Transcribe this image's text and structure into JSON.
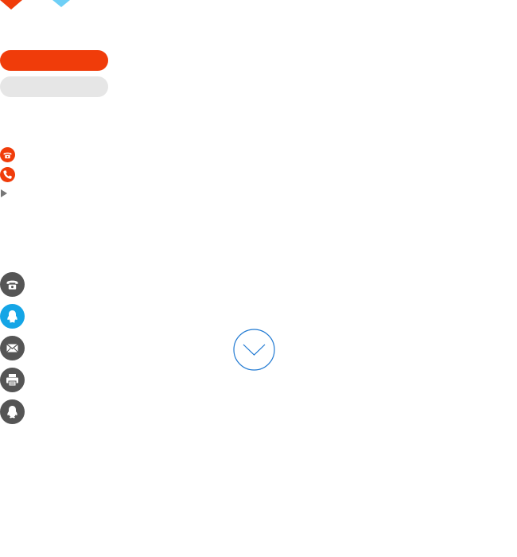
{
  "colors": {
    "accent_red": "#f03c0a",
    "accent_blue": "#14a5e6",
    "light_blue": "#6ecff6",
    "pill_gray": "#e6e6e6",
    "icon_dark": "#555555",
    "scroll_circle": "#1e78d2"
  },
  "icons": {
    "top": [
      "red-diamond-icon",
      "blue-diamond-icon"
    ],
    "small": [
      "telephone-icon",
      "phone-handset-icon",
      "play-arrow-icon"
    ],
    "side": [
      "telephone-icon",
      "qq-penguin-icon",
      "mail-icon",
      "printer-icon",
      "qq-penguin-icon"
    ],
    "scroll": "chevron-down-icon"
  },
  "state": {
    "active_side_icon": "qq-penguin-icon",
    "active_pill": "red-pill"
  }
}
